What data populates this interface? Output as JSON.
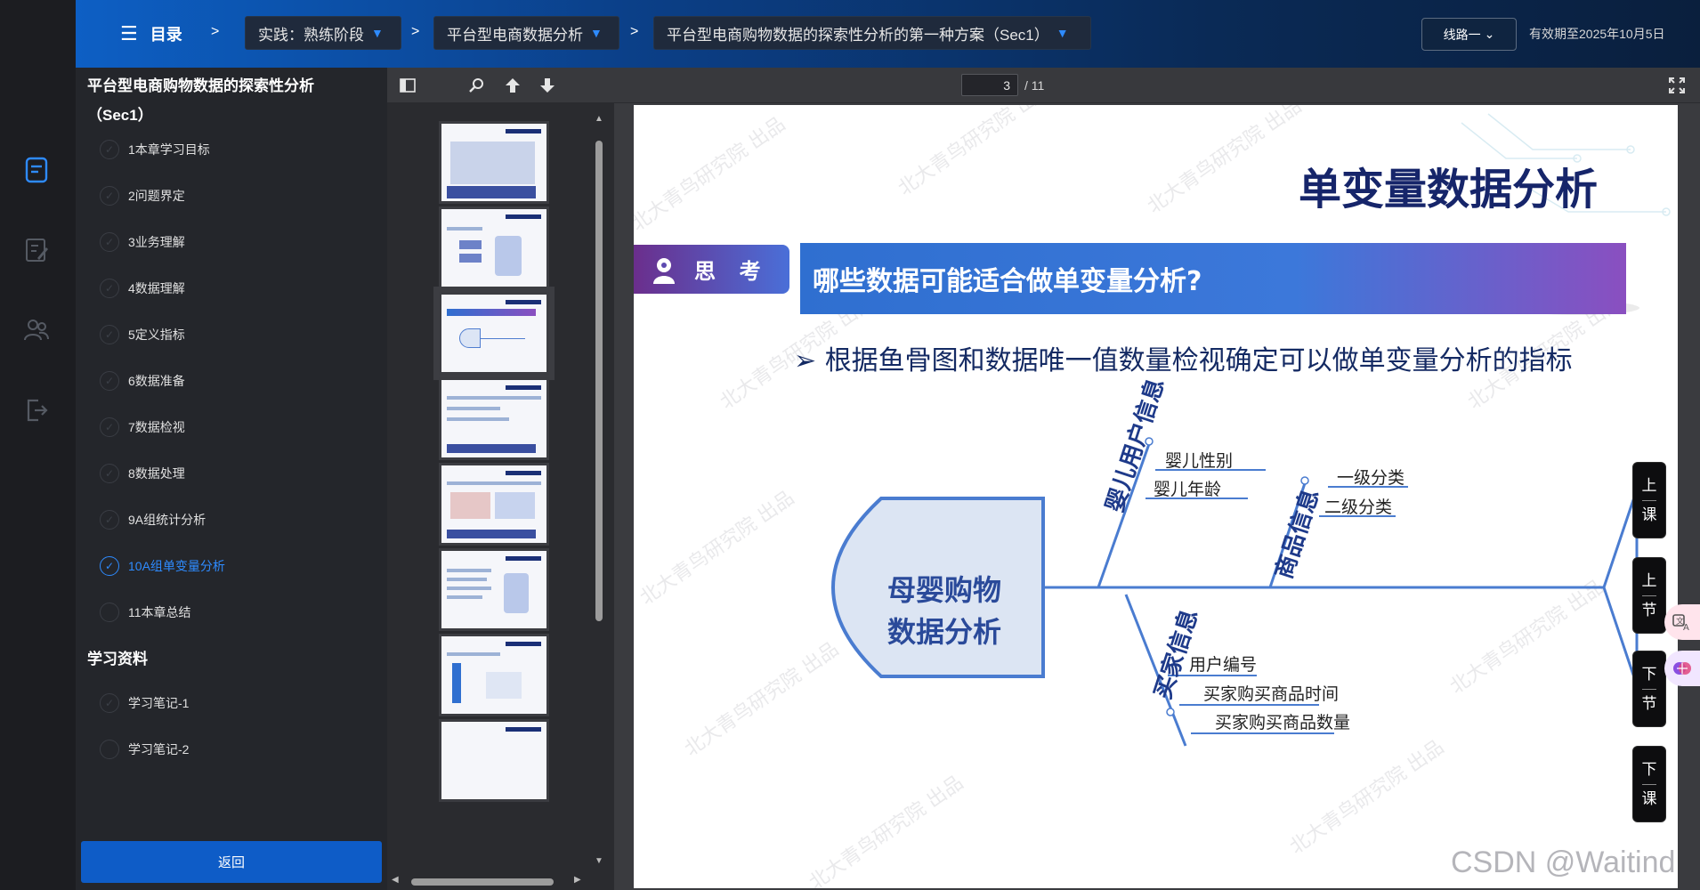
{
  "header": {
    "menu_label": "目录",
    "crumb_sep": ">",
    "crumbs": [
      {
        "label": "实践：熟练阶段"
      },
      {
        "label": "平台型电商数据分析"
      },
      {
        "label": "平台型电商购物数据的探索性分析的第一种方案（Sec1）"
      }
    ],
    "route_label": "线路一",
    "expire_text": "有效期至2025年10月5日"
  },
  "sidebar": {
    "title": "平台型电商购物数据的探索性分析（Sec1）",
    "chapters": [
      {
        "label": "1本章学习目标",
        "completed": true
      },
      {
        "label": "2问题界定",
        "completed": true
      },
      {
        "label": "3业务理解",
        "completed": true
      },
      {
        "label": "4数据理解",
        "completed": true
      },
      {
        "label": "5定义指标",
        "completed": true
      },
      {
        "label": "6数据准备",
        "completed": true
      },
      {
        "label": "7数据检视",
        "completed": true
      },
      {
        "label": "8数据处理",
        "completed": true
      },
      {
        "label": "9A组统计分析",
        "completed": true
      },
      {
        "label": "10A组单变量分析",
        "completed": true,
        "active": true
      },
      {
        "label": "11本章总结",
        "completed": false
      }
    ],
    "section_title": "学习资料",
    "materials": [
      {
        "label": "学习笔记-1",
        "completed": true
      },
      {
        "label": "学习笔记-2",
        "completed": false
      }
    ],
    "back_label": "返回"
  },
  "pdf": {
    "page_current": "3",
    "page_total": "/ 11",
    "thumb_count": 8,
    "active_thumb": 3
  },
  "slide": {
    "title": "单变量数据分析",
    "think_tag": "思 考",
    "question": "哪些数据可能适合做单变量分析?",
    "bullet": "根据鱼骨图和数据唯一值数量检视确定可以做单变量分析的指标",
    "fishbone": {
      "head_line1": "母婴购物",
      "head_line2": "数据分析",
      "categories": [
        {
          "name": "婴儿用户信息",
          "items": [
            "婴儿性别",
            "婴儿年龄"
          ]
        },
        {
          "name": "商品信息",
          "items": [
            "一级分类",
            "二级分类"
          ]
        },
        {
          "name": "买家信息",
          "items": [
            "用户编号",
            "买家购买商品时间",
            "买家购买商品数量"
          ]
        }
      ]
    },
    "watermark": "北大青鸟研究院 出品"
  },
  "side_controls": [
    {
      "line1": "上",
      "line2": "课"
    },
    {
      "line1": "上",
      "line2": "节"
    },
    {
      "line1": "下",
      "line2": "节"
    },
    {
      "line1": "下",
      "line2": "课"
    }
  ],
  "credit": "CSDN @Waitind",
  "colors": {
    "accent": "#2e8bff",
    "back_button": "#0e5cc7",
    "slide_title": "#16256a"
  }
}
